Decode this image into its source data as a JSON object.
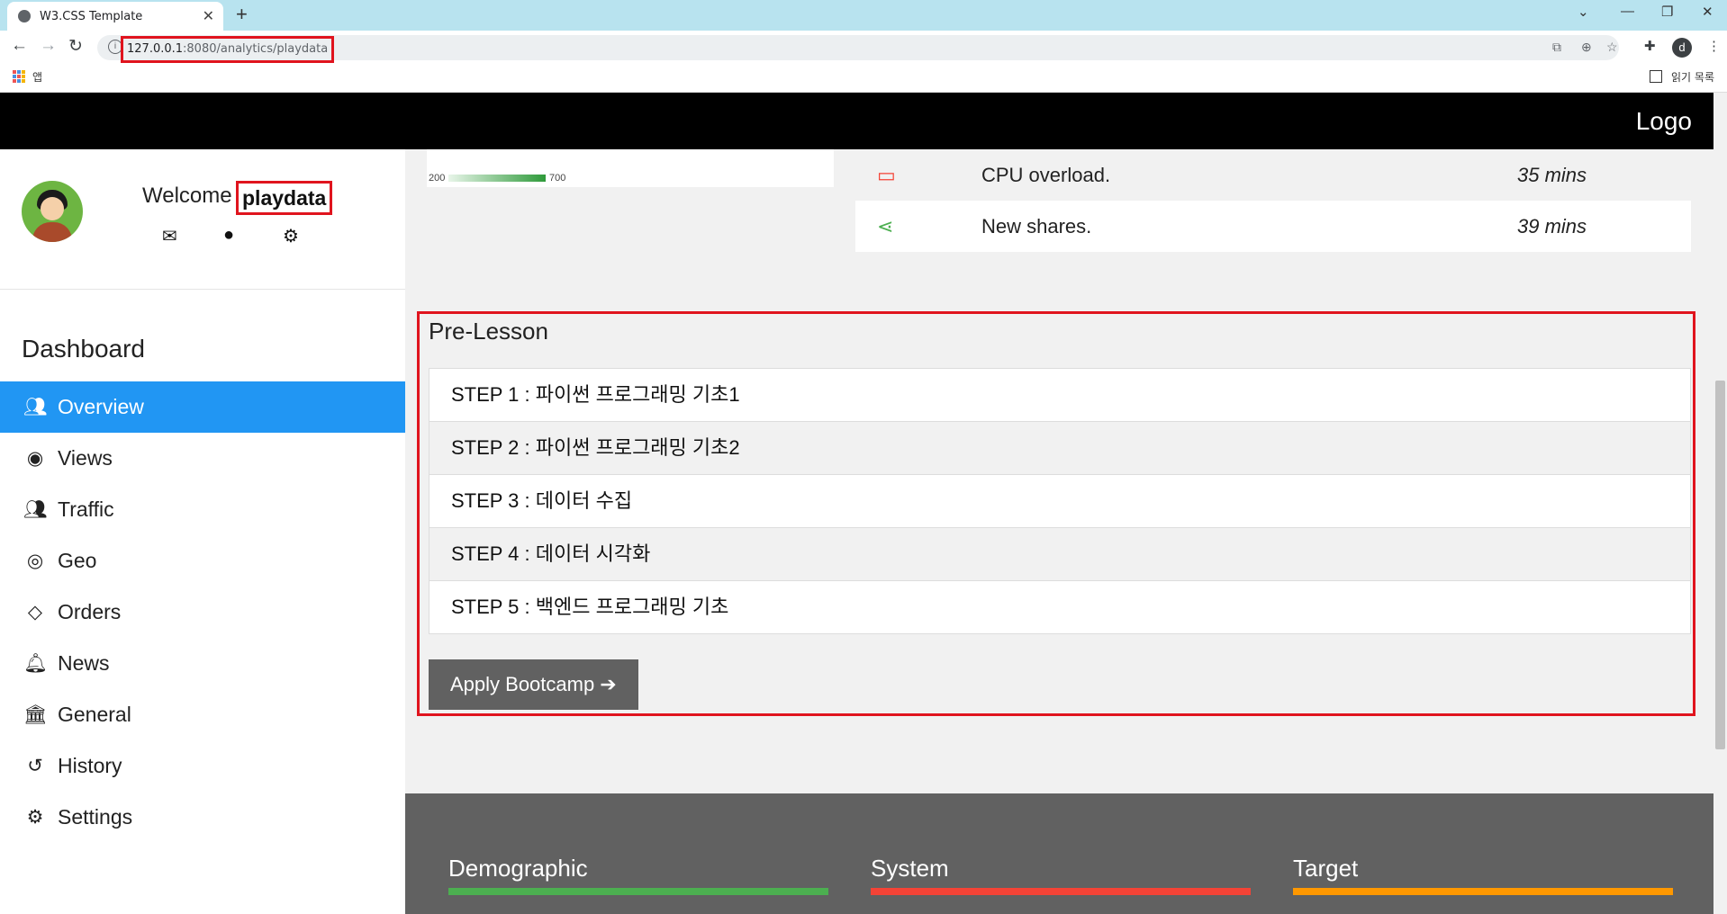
{
  "browser": {
    "tab_title": "W3.CSS Template",
    "url_host": "127.0.0.1",
    "url_path": ":8080/analytics/playdata",
    "bookmarks_apps_label": "앱",
    "reading_list_label": "읽기 목록",
    "profile_initial": "d"
  },
  "topbar": {
    "logo": "Logo"
  },
  "sidebar": {
    "welcome": "Welcome",
    "username": "playdata",
    "dashboard_title": "Dashboard",
    "menu": [
      {
        "label": "Overview",
        "icon": "users-icon"
      },
      {
        "label": "Views",
        "icon": "eye-icon"
      },
      {
        "label": "Traffic",
        "icon": "users-icon"
      },
      {
        "label": "Geo",
        "icon": "bullseye-icon"
      },
      {
        "label": "Orders",
        "icon": "diamond-icon"
      },
      {
        "label": "News",
        "icon": "bell-icon"
      },
      {
        "label": "General",
        "icon": "bank-icon"
      },
      {
        "label": "History",
        "icon": "history-icon"
      },
      {
        "label": "Settings",
        "icon": "gear-icon"
      }
    ],
    "active_item": "Overview"
  },
  "gauge": {
    "min_label": "200",
    "max_label": "700"
  },
  "feed": [
    {
      "text": "CPU overload.",
      "time": "35 mins",
      "icon": "laptop-icon",
      "color": "#f44336"
    },
    {
      "text": "New shares.",
      "time": "39 mins",
      "icon": "share-icon",
      "color": "#4CAF50"
    }
  ],
  "prelesson": {
    "title": "Pre-Lesson",
    "steps": [
      {
        "prefix": "STEP 1 : ",
        "title": "파이썬 프로그래밍 기초1"
      },
      {
        "prefix": "STEP 2 : ",
        "title": "파이썬 프로그래밍 기초2"
      },
      {
        "prefix": "STEP 3 : ",
        "title": "데이터 수집"
      },
      {
        "prefix": "STEP 4 : ",
        "title": "데이터 시각화"
      },
      {
        "prefix": "STEP 5 : ",
        "title": "백엔드 프로그래밍 기초"
      }
    ],
    "apply_label": "Apply Bootcamp ➔"
  },
  "footer": {
    "columns": [
      {
        "title": "Demographic",
        "color": "#4CAF50"
      },
      {
        "title": "System",
        "color": "#f44336"
      },
      {
        "title": "Target",
        "color": "#ff9800"
      }
    ]
  },
  "colors": {
    "accent": "#2196F3",
    "highlight_box": "#e0141e"
  }
}
